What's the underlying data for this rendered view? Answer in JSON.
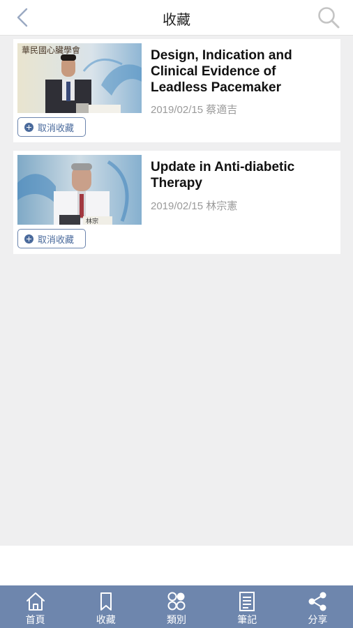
{
  "header": {
    "title": "收藏",
    "back_icon": "chevron-left-icon",
    "search_icon": "search-icon"
  },
  "favorites": [
    {
      "title": "Design, Indication and Clinical Evidence of Leadless Pacemaker",
      "meta": "2019/02/15 蔡適吉",
      "button_label": "取消收藏",
      "thumb_text": "華民國心臟學會"
    },
    {
      "title": "Update in Anti-diabetic Therapy",
      "meta": "2019/02/15 林宗憲",
      "button_label": "取消收藏",
      "thumb_text": "林宗"
    }
  ],
  "tabs": [
    {
      "label": "首頁",
      "icon": "home-icon"
    },
    {
      "label": "收藏",
      "icon": "bookmark-icon"
    },
    {
      "label": "類別",
      "icon": "category-icon"
    },
    {
      "label": "筆記",
      "icon": "notes-icon"
    },
    {
      "label": "分享",
      "icon": "share-icon"
    }
  ],
  "colors": {
    "tabbar": "#6e86ad",
    "accent": "#4a6a9c",
    "background": "#efeff0"
  }
}
